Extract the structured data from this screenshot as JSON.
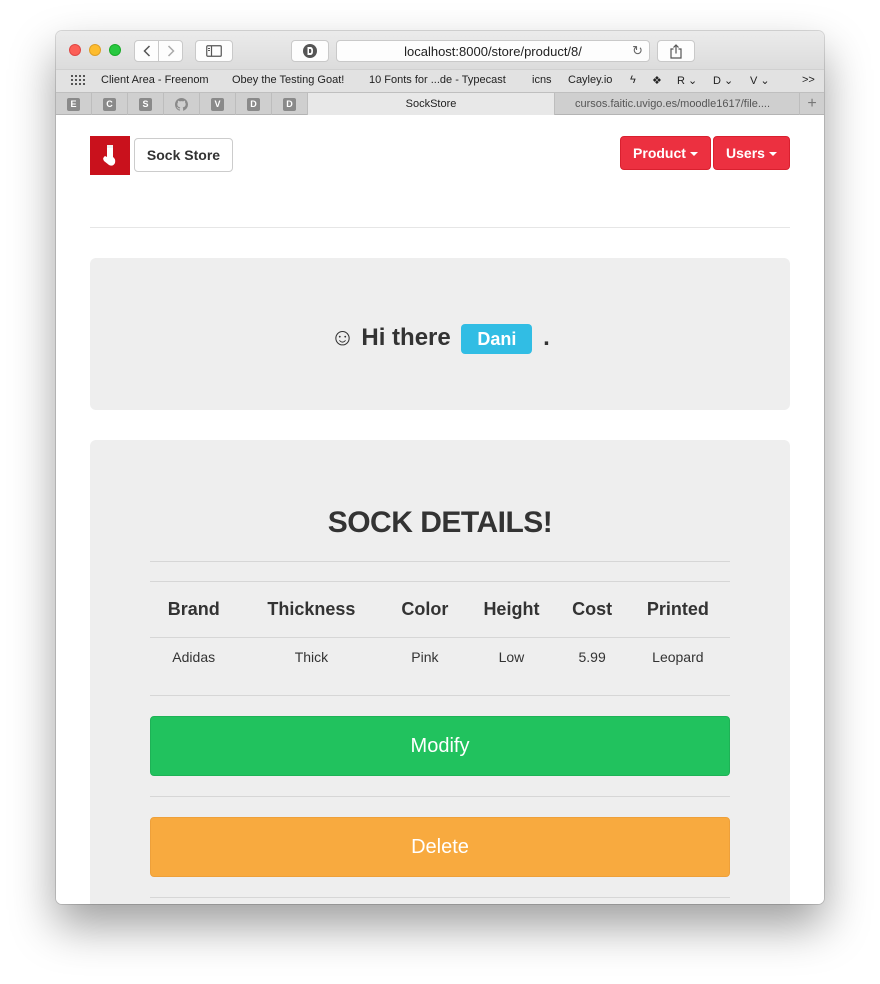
{
  "browser": {
    "url": "localhost:8000/store/product/8/",
    "bookmarks": [
      "Client Area - Freenom",
      "Obey the Testing Goat!",
      "10 Fonts for ...de - Typecast",
      "icns",
      "Cayley.io",
      "R",
      "D",
      "V"
    ],
    "overflow": ">>",
    "pinned_tabs": [
      "E",
      "C",
      "S",
      "V",
      "D",
      "D"
    ],
    "tabs": [
      {
        "title": "SockStore",
        "active": true
      },
      {
        "title": "cursos.faitic.uvigo.es/moodle1617/file....",
        "active": false
      }
    ],
    "new_tab": "+"
  },
  "navbar": {
    "brand": "Sock Store",
    "product_menu": "Product",
    "users_menu": "Users"
  },
  "greeting": {
    "emoji": "☺",
    "text": "Hi there",
    "username": "Dani",
    "suffix": "."
  },
  "details": {
    "title": "SOCK DETAILS!",
    "columns": [
      "Brand",
      "Thickness",
      "Color",
      "Height",
      "Cost",
      "Printed"
    ],
    "row": [
      "Adidas",
      "Thick",
      "Pink",
      "Low",
      "5.99",
      "Leopard"
    ],
    "modify_label": "Modify",
    "delete_label": "Delete"
  },
  "colors": {
    "nav_button": "#ec3040",
    "user_label": "#31bde4",
    "modify": "#21c25e",
    "delete": "#f8aa3f",
    "logo_bg": "#c9111c"
  }
}
